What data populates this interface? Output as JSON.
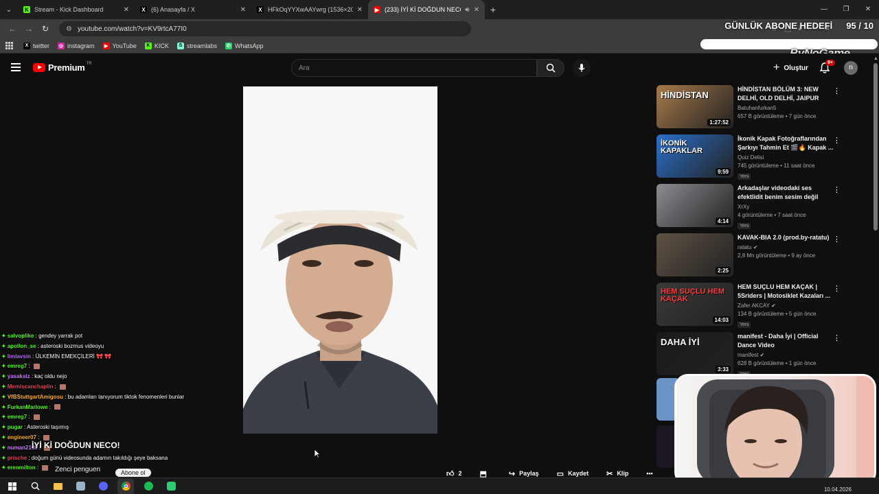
{
  "browser": {
    "tabs": [
      {
        "title": "Stream - Kick Dashboard",
        "active": false,
        "fav": "K",
        "fav_color": "#53fc18"
      },
      {
        "title": "(6) Anasayfa / X",
        "active": false,
        "fav": "X",
        "fav_color": "#000000"
      },
      {
        "title": "HFkOqYYXwAAYwrg (1536×20",
        "active": false,
        "fav": "X",
        "fav_color": "#000000"
      },
      {
        "title": "(233) İYİ Kİ DOĞDUN NECO",
        "active": true,
        "fav": "▶",
        "fav_color": "#ff0000"
      }
    ],
    "url": "youtube.com/watch?v=KV9rtcA77I0",
    "bookmarks": [
      {
        "label": "twitter",
        "icon": "x-icon",
        "color": "#000000",
        "glyph": "X"
      },
      {
        "label": "instagram",
        "icon": "instagram-icon",
        "color": "#d6249f",
        "glyph": "◎"
      },
      {
        "label": "YouTube",
        "icon": "youtube-icon",
        "color": "#ff0000",
        "glyph": "▶"
      },
      {
        "label": "KICK",
        "icon": "kick-icon",
        "color": "#53fc18",
        "glyph": "K"
      },
      {
        "label": "streamlabs",
        "icon": "streamlabs-icon",
        "color": "#80f5d2",
        "glyph": "S"
      },
      {
        "label": "WhatsApp",
        "icon": "whatsapp-icon",
        "color": "#25d366",
        "glyph": "✆"
      }
    ]
  },
  "overlay": {
    "goal_title": "GÜNLÜK ABONE HEDEFİ",
    "goal_count": "95 / 10",
    "goal_progress": 1.0,
    "sponsor": "ByNoGame"
  },
  "youtube": {
    "logo": "Premium",
    "logo_region": "TR",
    "search_placeholder": "Ara",
    "create_label": "Oluştur",
    "notif_count": "9+",
    "avatar_letter": "n"
  },
  "actions": {
    "likes": "2",
    "share": "Paylaş",
    "save": "Kaydet",
    "clip": "Klip"
  },
  "recommendations": [
    {
      "title": "HİNDİSTAN BÖLÜM 3: NEW DELHİ, OLD DELHİ, JAIPUR",
      "channel": "Batuhanfurkan5",
      "meta": "657 B görüntüleme • 7 gün önce",
      "duration": "1:27:52",
      "new": "",
      "verified": false,
      "thumb_text": "HİNDİSTAN",
      "thumb_bg": "#a77a4a"
    },
    {
      "title": "İkonik Kapak Fotoğraflarından Şarkıyı Tahmin Et 🎬🔥 Kapak ...",
      "channel": "Quiz Delisi",
      "meta": "745 görüntüleme • 11 saat önce",
      "duration": "9:59",
      "new": "Yeni",
      "verified": false,
      "thumb_text": "İKONİK KAPAKLAR",
      "thumb_bg": "#2a6fc9"
    },
    {
      "title": "Arkadaşlar videodaki ses efektlidit benim sesim değil",
      "channel": "XrXy",
      "meta": "4 görüntüleme • 7 saat önce",
      "duration": "4:14",
      "new": "Yeni",
      "verified": false,
      "thumb_text": "",
      "thumb_bg": "#8c8c92"
    },
    {
      "title": "KAVAK-BIA 2.0 (prod.by-ratatu)",
      "channel": "ratatu",
      "meta": "2,8 Mn görüntüleme • 9 ay önce",
      "duration": "2:25",
      "new": "",
      "verified": true,
      "thumb_text": "",
      "thumb_bg": "#5e5244"
    },
    {
      "title": "HEM SUÇLU HEM KAÇAK | 5Sriders | Motosiklet Kazaları ...",
      "channel": "Zafer AKCAY",
      "meta": "134 B görüntüleme • 5 gün önce",
      "duration": "14:03",
      "new": "Yeni",
      "verified": true,
      "thumb_text": "HEM SUÇLU HEM KAÇAK",
      "thumb_bg": "#3a3a3a"
    },
    {
      "title": "manifest - Daha İyi | Official Dance Video",
      "channel": "manifest",
      "meta": "628 B görüntüleme • 1 gün önce",
      "duration": "3:33",
      "new": "Yeni",
      "verified": true,
      "thumb_text": "DAHA İYİ",
      "thumb_bg": "#1a1a1a"
    }
  ],
  "chat": {
    "lines": [
      {
        "user": "salvoplike",
        "color": "#53fc18",
        "text": "gendey yarrak pot",
        "emote": false
      },
      {
        "user": "apollon_se",
        "color": "#53fc18",
        "text": "asteroski bozmus videoyu",
        "emote": false
      },
      {
        "user": "limlavsin",
        "color": "#b96cff",
        "text": "ÜLKEMİN EMEKÇİLERİ 🎀 🎀",
        "emote": false
      },
      {
        "user": "emreg7",
        "color": "#53fc18",
        "text": "",
        "emote": true
      },
      {
        "user": "yasaksiz",
        "color": "#c97bff",
        "text": "kaç oldu nejo",
        "emote": false
      },
      {
        "user": "Memiscanchaplin",
        "color": "#e0485a",
        "text": "",
        "emote": true
      },
      {
        "user": "VfBStuttgartAmigosu",
        "color": "#ffb020",
        "text": "bu adamları tanıyorum tiktok fenomenleri bunlar",
        "emote": false
      },
      {
        "user": "FurkanMarlowe",
        "color": "#53fc18",
        "text": "",
        "emote": true
      },
      {
        "user": "emreg7",
        "color": "#53fc18",
        "text": "",
        "emote": true
      },
      {
        "user": "pugar",
        "color": "#53fc18",
        "text": "Asteroski taşımış",
        "emote": false
      },
      {
        "user": "engineer07",
        "color": "#ffb020",
        "text": "",
        "emote": true
      },
      {
        "user": "numan2108",
        "color": "#c97bff",
        "text": "",
        "emote": true
      },
      {
        "user": "prische",
        "color": "#e0485a",
        "text": "doğum günü videosunda adamın takıldığı şeye baksana",
        "emote": false
      },
      {
        "user": "erenmilton",
        "color": "#53fc18",
        "text": "",
        "emote": true
      }
    ],
    "headline": "İYİ Kİ DOĞDUN NECO!",
    "channel_name": "Zenci penguen",
    "subscribe_label": "Abone ol"
  },
  "taskbar": {
    "date": "10.04.2026"
  }
}
